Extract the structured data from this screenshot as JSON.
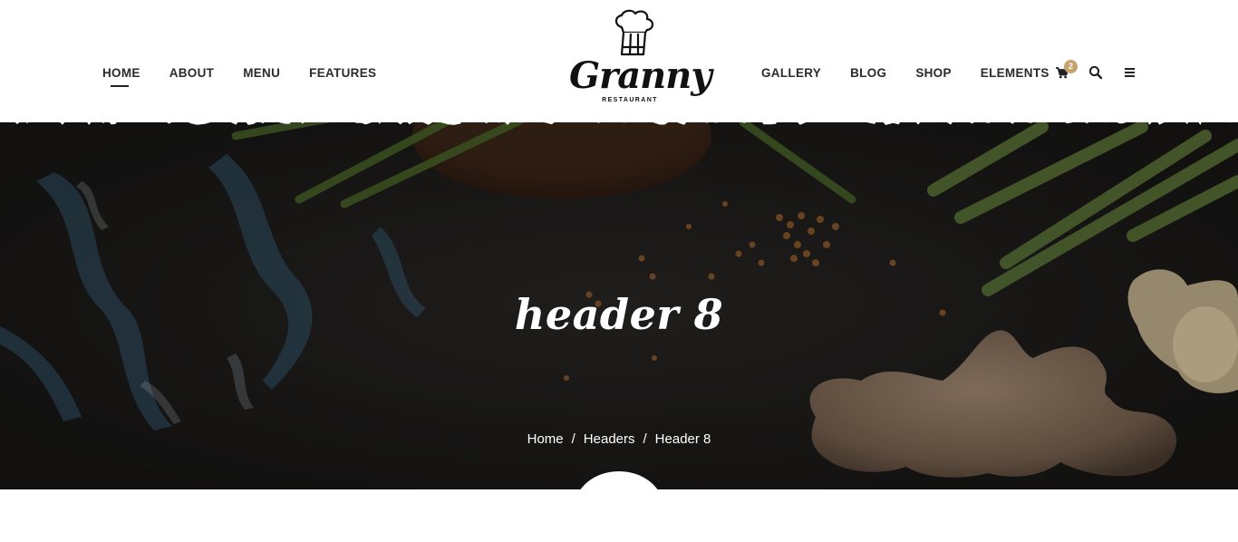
{
  "nav": {
    "left": [
      {
        "label": "HOME",
        "active": true
      },
      {
        "label": "ABOUT"
      },
      {
        "label": "MENU"
      },
      {
        "label": "FEATURES"
      }
    ],
    "right": [
      {
        "label": "GALLERY"
      },
      {
        "label": "BLOG"
      },
      {
        "label": "SHOP"
      },
      {
        "label": "ELEMENTS"
      }
    ]
  },
  "logo": {
    "wordmark": "Granny",
    "subtitle": "RESTAURANT",
    "icon": "chef-hat-icon"
  },
  "cart": {
    "count": "2",
    "icon": "cart-icon"
  },
  "icons": {
    "search": "search-icon",
    "menu": "hamburger-menu-icon"
  },
  "hero": {
    "title": "header 8",
    "breadcrumb": [
      "Home",
      "Headers",
      "Header 8"
    ],
    "separator": "/"
  },
  "colors": {
    "accent": "#c7a26a",
    "nav_text": "#2b2b2b",
    "hero_bg": "#1f1d1c",
    "white": "#ffffff"
  }
}
